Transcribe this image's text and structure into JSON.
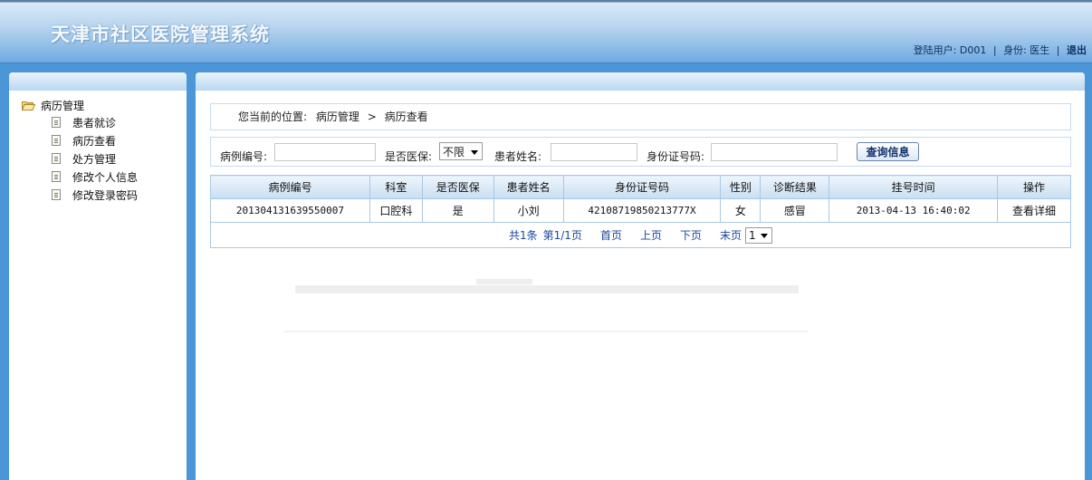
{
  "header": {
    "title": "天津市社区医院管理系统",
    "user_label": "登陆用户:",
    "user_id": "D001",
    "role_label": "身份:",
    "role": "医生",
    "logout": "退出"
  },
  "sidebar": {
    "root": "病历管理",
    "items": [
      {
        "label": "患者就诊"
      },
      {
        "label": "病历查看"
      },
      {
        "label": "处方管理"
      },
      {
        "label": "修改个人信息"
      },
      {
        "label": "修改登录密码"
      }
    ]
  },
  "breadcrumb": {
    "prefix": "您当前的位置:",
    "level1": "病历管理",
    "separator": ">",
    "level2": "病历查看"
  },
  "search": {
    "record_no_label": "病例编号:",
    "record_no_value": "",
    "insurance_label": "是否医保:",
    "insurance_value": "不限",
    "name_label": "患者姓名:",
    "name_value": "",
    "id_label": "身份证号码:",
    "id_value": "",
    "button": "查询信息"
  },
  "table": {
    "headers": [
      "病例编号",
      "科室",
      "是否医保",
      "患者姓名",
      "身份证号码",
      "性别",
      "诊断结果",
      "挂号时间",
      "操作"
    ],
    "rows": [
      [
        "201304131639550007",
        "口腔科",
        "是",
        "小刘",
        "42108719850213777X",
        "女",
        "感冒",
        "2013-04-13 16:40:02",
        "查看详细"
      ]
    ]
  },
  "pager": {
    "total": "共1条",
    "page_info": "第1/1页",
    "first": "首页",
    "prev": "上页",
    "next": "下页",
    "last": "末页",
    "page_select": "1"
  },
  "colors": {
    "header_bg": "#8fbde6",
    "body_bg": "#4a96d6",
    "link": "#1a46a0",
    "grid_border": "#aac8e4"
  }
}
